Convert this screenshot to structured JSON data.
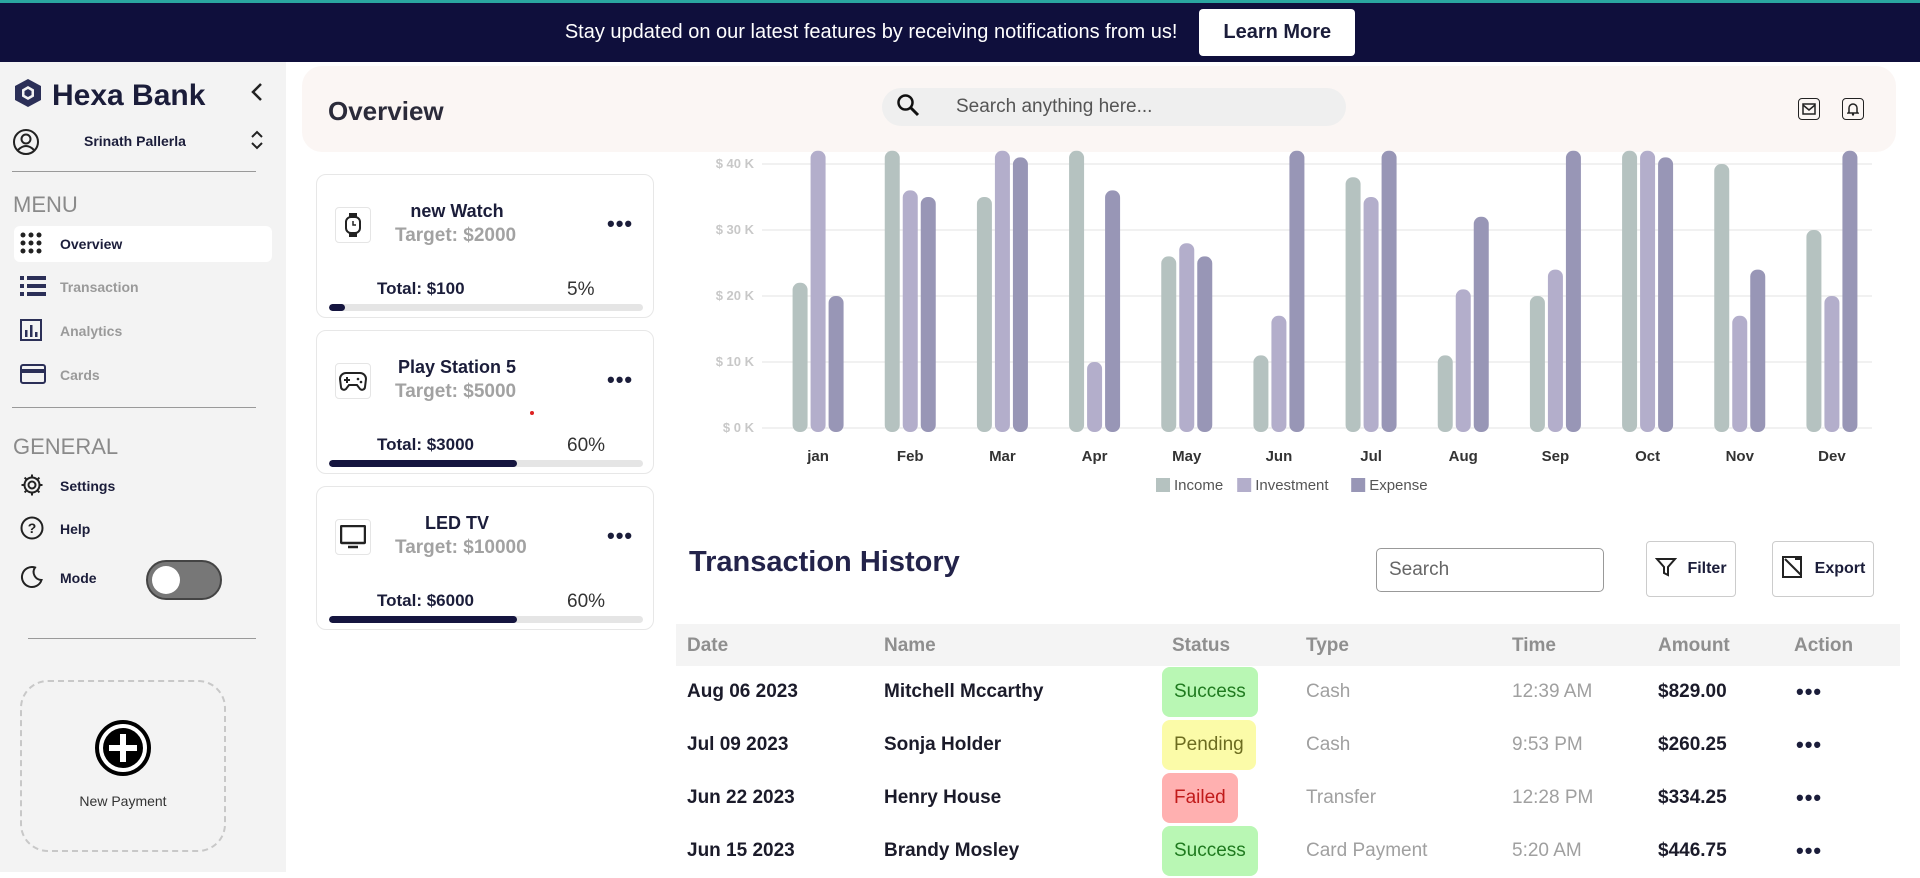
{
  "banner": {
    "text": "Stay updated on our latest features by receiving notifications from us!",
    "button": "Learn More"
  },
  "sidebar": {
    "brand": "Hexa Bank",
    "user": "Srinath Pallerla",
    "menu_title": "MENU",
    "menu": [
      {
        "label": "Overview",
        "icon": "grid-dots-icon",
        "active": true
      },
      {
        "label": "Transaction",
        "icon": "list-icon"
      },
      {
        "label": "Analytics",
        "icon": "bar-chart-icon"
      },
      {
        "label": "Cards",
        "icon": "credit-card-icon"
      }
    ],
    "general_title": "GENERAL",
    "general": [
      {
        "label": "Settings",
        "icon": "gear-icon"
      },
      {
        "label": "Help",
        "icon": "help-circle-icon"
      },
      {
        "label": "Mode",
        "icon": "moon-icon"
      }
    ],
    "mode_on": false,
    "new_payment": "New Payment"
  },
  "header": {
    "title": "Overview",
    "search_placeholder": "Search anything here..."
  },
  "goals": [
    {
      "name": "new Watch",
      "target": "Target: $2000",
      "total": "Total: $100",
      "percent": "5%",
      "progress": 0.05,
      "icon": "watch-icon"
    },
    {
      "name": "Play Station 5",
      "target": "Target: $5000",
      "total": "Total: $3000",
      "percent": "60%",
      "progress": 0.6,
      "icon": "gamepad-icon"
    },
    {
      "name": "LED TV",
      "target": "Target: $10000",
      "total": "Total: $6000",
      "percent": "60%",
      "progress": 0.6,
      "icon": "tv-icon"
    }
  ],
  "chart_data": {
    "type": "bar",
    "categories": [
      "jan",
      "Feb",
      "Mar",
      "Apr",
      "May",
      "Jun",
      "Jul",
      "Aug",
      "Sep",
      "Oct",
      "Nov",
      "Dev"
    ],
    "yticks": [
      "$ 0 K",
      "$ 10 K",
      "$ 20 K",
      "$ 30 K",
      "$ 40 K"
    ],
    "ylim": [
      0,
      42
    ],
    "series": [
      {
        "name": "Income",
        "color": "#b5c2c0",
        "values": [
          22,
          45,
          35,
          45,
          26,
          11,
          38,
          11,
          20,
          45,
          40,
          30
        ]
      },
      {
        "name": "Investment",
        "color": "#b3aecb",
        "values": [
          45,
          36,
          45,
          10,
          28,
          17,
          35,
          21,
          24,
          45,
          17,
          20
        ]
      },
      {
        "name": "Expense",
        "color": "#9896b6",
        "values": [
          20,
          35,
          41,
          36,
          26,
          45,
          45,
          32,
          45,
          41,
          24,
          45
        ]
      }
    ],
    "legend": "bottom-center"
  },
  "transactions": {
    "title": "Transaction History",
    "search_placeholder": "Search",
    "filter": "Filter",
    "export": "Export",
    "columns": [
      "Date",
      "Name",
      "Status",
      "Type",
      "Time",
      "Amount",
      "Action"
    ],
    "rows": [
      {
        "date": "Aug 06 2023",
        "name": "Mitchell Mccarthy",
        "status": "Success",
        "type": "Cash",
        "time": "12:39 AM",
        "amount": "$829.00"
      },
      {
        "date": "Jul 09 2023",
        "name": "Sonja Holder",
        "status": "Pending",
        "type": "Cash",
        "time": "9:53 PM",
        "amount": "$260.25"
      },
      {
        "date": "Jun 22 2023",
        "name": "Henry House",
        "status": "Failed",
        "type": "Transfer",
        "time": "12:28 PM",
        "amount": "$334.25"
      },
      {
        "date": "Jun 15 2023",
        "name": "Brandy Mosley",
        "status": "Success",
        "type": "Card Payment",
        "time": "5:20 AM",
        "amount": "$446.75"
      }
    ],
    "status_colors": {
      "Success": {
        "bg": "#b9f7b4",
        "fg": "#1f7a1f"
      },
      "Pending": {
        "bg": "#fbfba8",
        "fg": "#6c6c20"
      },
      "Failed": {
        "bg": "#ffb0b0",
        "fg": "#c11a1a"
      }
    }
  }
}
